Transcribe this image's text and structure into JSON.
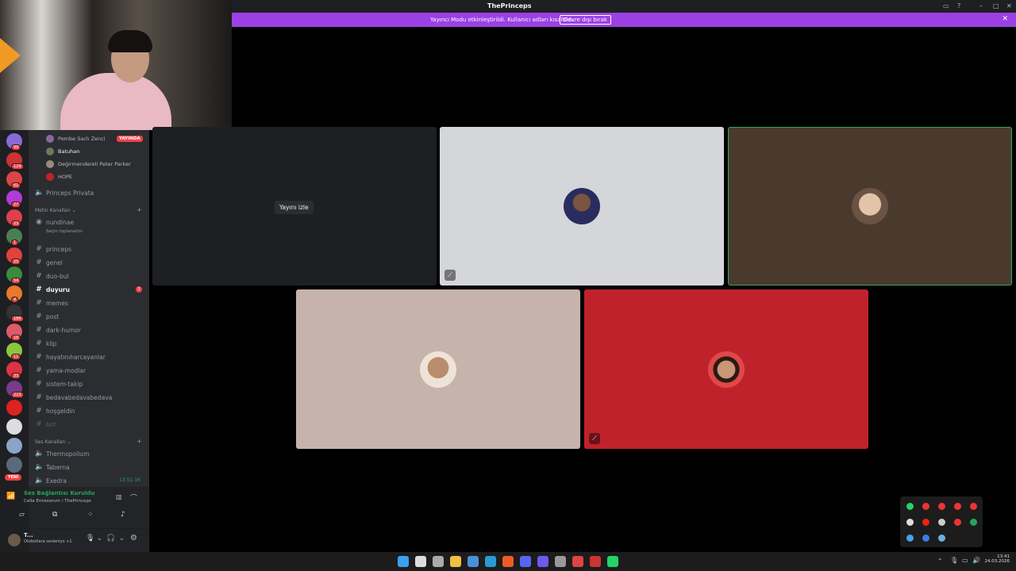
{
  "window": {
    "title": "ThePrinceps"
  },
  "banner": {
    "message": "Yayıncı Modu etkinleştirildi. Kullanıcı adları kısaltıldı.",
    "button": "Devre dışı bırak"
  },
  "guild_badges": [
    "99",
    "129",
    "61",
    "27",
    "23",
    "1",
    "25",
    "54",
    "4",
    "180",
    "18",
    "11",
    "33",
    "223"
  ],
  "guild_new_label": "YENİ",
  "voice_users": [
    {
      "name": "Pembe Saclı Zenci",
      "live": "YAYINDA"
    },
    {
      "name": "Batuhan"
    },
    {
      "name": "Değirmendereli Peter Parker"
    },
    {
      "name": "HOPE"
    }
  ],
  "voice_channel_privata": "Princeps Privata",
  "text_section": "Metin Kanalları",
  "text_channels": [
    {
      "name": "nundinae",
      "sub": "Seçin toplanalım"
    },
    {
      "name": "princeps"
    },
    {
      "name": "genel"
    },
    {
      "name": "duo-bul"
    },
    {
      "name": "duyuru",
      "badge": "3"
    },
    {
      "name": "memes"
    },
    {
      "name": "post"
    },
    {
      "name": "dark-humor"
    },
    {
      "name": "klip"
    },
    {
      "name": "hayatınıharcayanlar"
    },
    {
      "name": "yama-modlar"
    },
    {
      "name": "sistem-takip"
    },
    {
      "name": "bedavabedavabedava"
    },
    {
      "name": "hoşgeldin"
    },
    {
      "name": "bot"
    }
  ],
  "voice_section": "Ses Kanalları",
  "voice_channels": [
    {
      "name": "Thermopolium"
    },
    {
      "name": "Taberna"
    },
    {
      "name": "Exedra",
      "time": "13:51:16"
    }
  ],
  "connection": {
    "status": "Ses Bağlantısı Kuruldu",
    "detail": "Cella Emissorum / ThePrinceps"
  },
  "user": {
    "name": "T...",
    "status": "Otobotlara sesleniyo +1"
  },
  "stream": {
    "watch_label": "Yayını izle"
  },
  "colors": {
    "banner": "#9b41e3",
    "live": "#ed4245",
    "speaking": "#3ba55d",
    "tile_gray": "#d5d6da",
    "tile_brown": "#4a3a2e",
    "tile_beige": "#c6b3ab",
    "tile_red": "#c0222c"
  },
  "clock": {
    "time": "13:41",
    "date": "24.03.2026"
  }
}
